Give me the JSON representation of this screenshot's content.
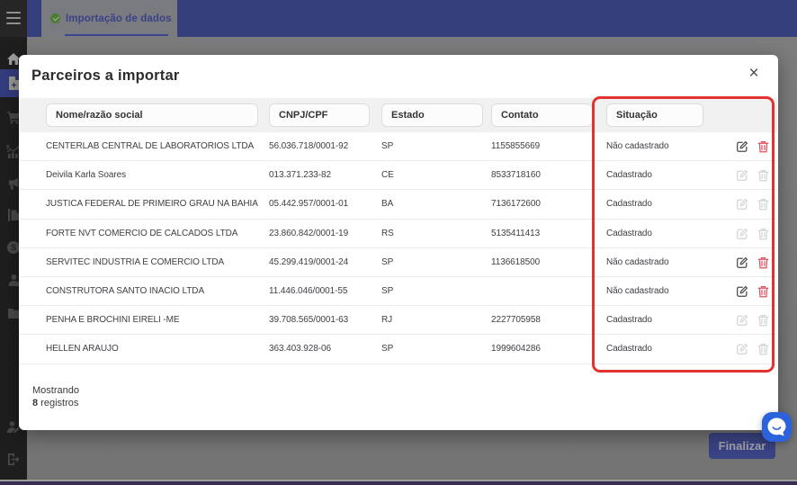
{
  "topbar": {
    "tab": {
      "label": "Importação de dados",
      "status_icon": "check-circle-icon",
      "active": true
    }
  },
  "sidebar": {
    "items": [
      {
        "icon": "menu-icon"
      },
      {
        "icon": "home-icon"
      },
      {
        "icon": "file-import-icon",
        "active": true
      },
      {
        "icon": "cart-icon"
      },
      {
        "icon": "sales-chart-icon"
      },
      {
        "icon": "megaphone-icon"
      },
      {
        "icon": "copy-icon"
      },
      {
        "icon": "money-coin-icon"
      },
      {
        "icon": "person-icon"
      },
      {
        "icon": "folder-icon"
      },
      {
        "icon": "person-edit-icon"
      },
      {
        "icon": "logout-icon"
      }
    ]
  },
  "modal": {
    "title": "Parceiros a importar",
    "close_label": "×",
    "columns": [
      "Nome/razão social",
      "CNPJ/CPF",
      "Estado",
      "Contato",
      "Situação"
    ],
    "rows": [
      {
        "name": "CENTERLAB CENTRAL DE LABORATORIOS LTDA",
        "cnpj": "56.036.718/0001-92",
        "estado": "SP",
        "contato": "1155855669",
        "situacao": "Não cadastrado",
        "actions_enabled": true
      },
      {
        "name": "Deivila Karla Soares",
        "cnpj": "013.371.233-82",
        "estado": "CE",
        "contato": "8533718160",
        "situacao": "Cadastrado",
        "actions_enabled": false
      },
      {
        "name": "JUSTICA FEDERAL DE PRIMEIRO GRAU NA BAHIA",
        "cnpj": "05.442.957/0001-01",
        "estado": "BA",
        "contato": "7136172600",
        "situacao": "Cadastrado",
        "actions_enabled": false
      },
      {
        "name": "FORTE NVT COMERCIO DE CALCADOS LTDA",
        "cnpj": "23.860.842/0001-19",
        "estado": "RS",
        "contato": "5135411413",
        "situacao": "Cadastrado",
        "actions_enabled": false
      },
      {
        "name": "SERVITEC INDUSTRIA E COMERCIO LTDA",
        "cnpj": "45.299.419/0001-24",
        "estado": "SP",
        "contato": "1136618500",
        "situacao": "Não cadastrado",
        "actions_enabled": true
      },
      {
        "name": "CONSTRUTORA SANTO INACIO LTDA",
        "cnpj": "11.446.046/0001-55",
        "estado": "SP",
        "contato": "",
        "situacao": "Não cadastrado",
        "actions_enabled": true
      },
      {
        "name": "PENHA E BROCHINI EIRELI -ME",
        "cnpj": "39.708.565/0001-63",
        "estado": "RJ",
        "contato": "2227705958",
        "situacao": "Cadastrado",
        "actions_enabled": false
      },
      {
        "name": "HELLEN ARAUJO",
        "cnpj": "363.403.928-06",
        "estado": "SP",
        "contato": "1999604286",
        "situacao": "Cadastrado",
        "actions_enabled": false
      }
    ],
    "footer": {
      "showing_label": "Mostrando",
      "count": "8",
      "count_suffix": " registros"
    },
    "highlight": {
      "column": "Situação",
      "color": "#e23333"
    }
  },
  "actions": {
    "finalizar_label": "Finalizar"
  },
  "colors": {
    "topbar": "#343f7c",
    "sidebar": "#1e1e1e",
    "sidebar_active": "#333d7e",
    "backdrop": "#7b7b7b",
    "modal_bg": "#ffffff",
    "highlight_red": "#e23333",
    "check_green": "#4d7c32",
    "chat_blue": "#2c63dd",
    "footer_purple": "#3a2d54",
    "trash_red": "#e25062",
    "edit_dark": "#4a4a4a",
    "disabled_icon": "#d4d4d8"
  }
}
